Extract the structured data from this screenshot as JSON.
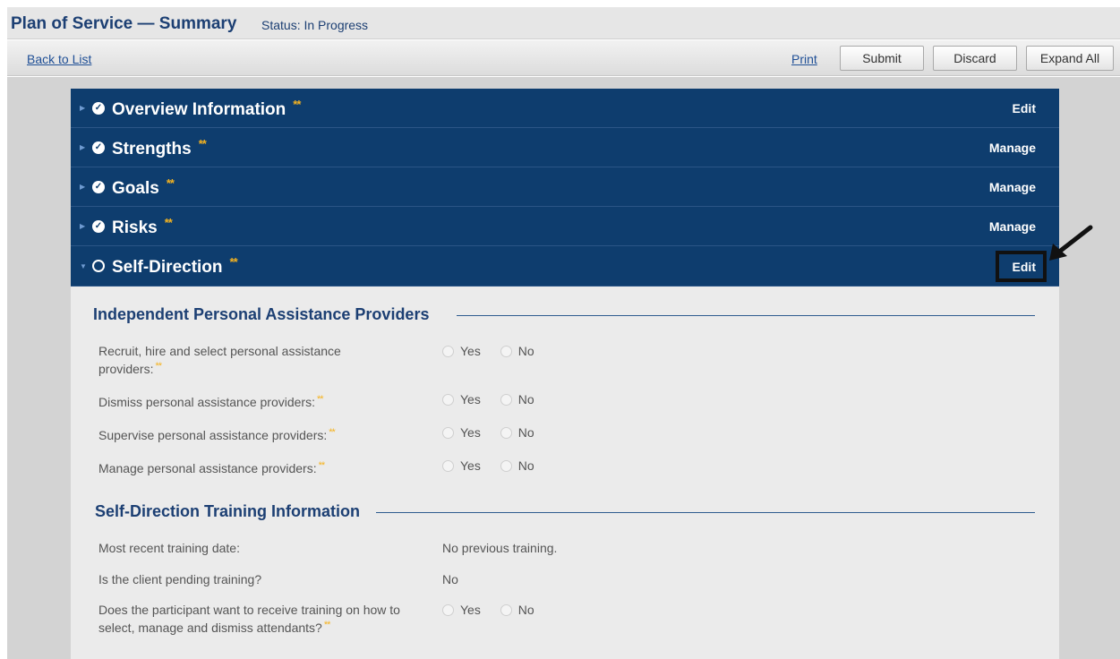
{
  "header": {
    "title": "Plan of Service — Summary",
    "status": "Status: In Progress"
  },
  "toolbar": {
    "back_label": "Back to List",
    "print_label": "Print",
    "submit_label": "Submit",
    "discard_label": "Discard",
    "expand_label": "Expand All"
  },
  "sections": [
    {
      "title": "Overview Information",
      "stars": "**",
      "action": "Edit",
      "completed": true
    },
    {
      "title": "Strengths",
      "stars": "**",
      "action": "Manage",
      "completed": true
    },
    {
      "title": "Goals",
      "stars": "**",
      "action": "Manage",
      "completed": true
    },
    {
      "title": "Risks",
      "stars": "**",
      "action": "Manage",
      "completed": true
    },
    {
      "title": "Self-Direction",
      "stars": "**",
      "action": "Edit",
      "completed": false
    }
  ],
  "providers_group": {
    "title": "Independent Personal Assistance Providers",
    "questions": [
      {
        "label": "Recruit, hire and select personal assistance providers:",
        "stars": "**",
        "yes": "Yes",
        "no": "No"
      },
      {
        "label": "Dismiss personal assistance providers:",
        "stars": "**",
        "yes": "Yes",
        "no": "No"
      },
      {
        "label": "Supervise personal assistance providers:",
        "stars": "**",
        "yes": "Yes",
        "no": "No"
      },
      {
        "label": "Manage personal assistance providers:",
        "stars": "**",
        "yes": "Yes",
        "no": "No"
      }
    ]
  },
  "training_group": {
    "title": "Self-Direction Training Information",
    "recent_label": "Most recent training date:",
    "recent_value": "No previous training.",
    "pending_label": "Is the client pending training?",
    "pending_value": "No",
    "want_label": "Does the participant want to receive training on how to select, manage and dismiss attendants?",
    "want_stars": "**",
    "yes": "Yes",
    "no": "No"
  },
  "colors": {
    "section_bg": "#0e3d6e",
    "accent_title": "#1c3f73",
    "required_star": "#f5b320"
  }
}
